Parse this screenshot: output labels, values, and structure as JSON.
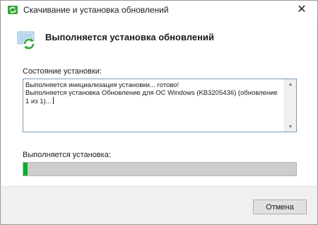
{
  "window": {
    "title": "Скачивание и установка обновлений",
    "close_glyph": "✕"
  },
  "header": {
    "title": "Выполняется установка обновлений",
    "icon": "windows-update-icon"
  },
  "status": {
    "label": "Состояние установки:",
    "lines": [
      "Выполняется инициализация установки... готово!",
      "Выполняется установка Обновление для ОС Windows (KB3205436) (обновление  1 из 1)..."
    ]
  },
  "progress": {
    "label": "Выполняется установка:",
    "fraction": 0.015,
    "color": "#06b025"
  },
  "buttons": {
    "cancel": "Отмена"
  },
  "colors": {
    "accent": "#06b025",
    "title_icon_green": "#3aa53a"
  }
}
